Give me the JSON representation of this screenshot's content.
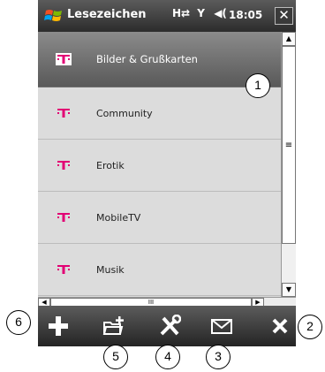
{
  "titlebar": {
    "title": "Lesezeichen",
    "time": "18:05",
    "icons": [
      "windows-start-icon",
      "data-connection-icon",
      "signal-icon",
      "volume-icon",
      "close-icon"
    ]
  },
  "list": {
    "items": [
      {
        "label": "Bilder & Grußkarten",
        "selected": true
      },
      {
        "label": "Community",
        "selected": false
      },
      {
        "label": "Erotik",
        "selected": false
      },
      {
        "label": "MobileTV",
        "selected": false
      },
      {
        "label": "Musik",
        "selected": false
      }
    ]
  },
  "toolbar": {
    "icons": [
      "add-icon",
      "new-folder-icon",
      "settings-tools-icon",
      "mail-icon",
      "delete-icon"
    ]
  },
  "callouts": [
    "1",
    "2",
    "3",
    "4",
    "5",
    "6"
  ],
  "colors": {
    "accent": "#e20074",
    "toolbar": "#3a3a3a",
    "list_bg": "#dcdcdc"
  }
}
